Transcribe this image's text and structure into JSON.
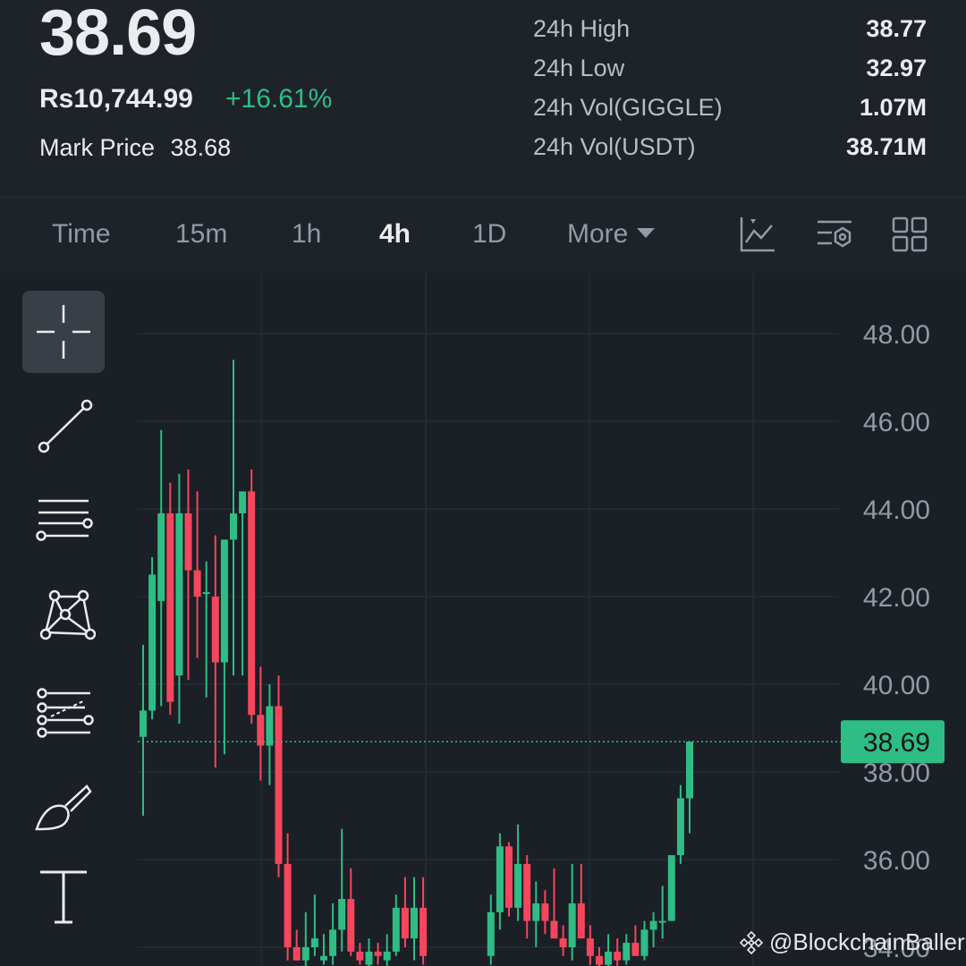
{
  "header": {
    "last_price": "38.69",
    "local_price": "Rs10,744.99",
    "change_pct": "+16.61%",
    "mark_label": "Mark Price",
    "mark_value": "38.68",
    "stats": [
      {
        "label": "24h High",
        "value": "38.77"
      },
      {
        "label": "24h Low",
        "value": "32.97"
      },
      {
        "label": "24h Vol(GIGGLE)",
        "value": "1.07M"
      },
      {
        "label": "24h Vol(USDT)",
        "value": "38.71M"
      }
    ]
  },
  "tabs": {
    "time": "Time",
    "m15": "15m",
    "h1": "1h",
    "h4": "4h",
    "d1": "1D",
    "more": "More"
  },
  "icons": {
    "indicator": "line-chart-icon",
    "settings": "chart-settings-icon",
    "layout": "grid-layout-icon",
    "crosshair": "crosshair-icon",
    "trend_line": "trend-line-icon",
    "horizontal_lines": "horizontal-lines-icon",
    "pattern": "pattern-icon",
    "fib": "fib-retracement-icon",
    "brush": "brush-icon",
    "text": "text-icon",
    "logo": "binance-logo-icon"
  },
  "colors": {
    "up": "#2ebd85",
    "down": "#f6465d",
    "background": "#1e2329"
  },
  "watermark": "@BlockchainBaller",
  "chart_data": {
    "type": "candlestick",
    "interval": "4h",
    "yticks": [
      "48.00",
      "46.00",
      "44.00",
      "42.00",
      "40.00",
      "38.00",
      "36.00",
      "34.00"
    ],
    "ylim": [
      33.6,
      48.5
    ],
    "current_price_label": "38.69",
    "current_price": 38.69,
    "candles": [
      {
        "o": 38.8,
        "h": 40.9,
        "l": 37.0,
        "c": 39.4
      },
      {
        "o": 39.4,
        "h": 42.9,
        "l": 39.2,
        "c": 42.5
      },
      {
        "o": 41.9,
        "h": 45.8,
        "l": 39.5,
        "c": 43.9
      },
      {
        "o": 43.9,
        "h": 44.6,
        "l": 39.3,
        "c": 39.6
      },
      {
        "o": 40.2,
        "h": 44.8,
        "l": 39.1,
        "c": 43.9
      },
      {
        "o": 43.9,
        "h": 44.9,
        "l": 40.1,
        "c": 42.6
      },
      {
        "o": 42.6,
        "h": 44.4,
        "l": 40.6,
        "c": 42.0
      },
      {
        "o": 42.1,
        "h": 42.8,
        "l": 39.7,
        "c": 42.1
      },
      {
        "o": 42.0,
        "h": 43.4,
        "l": 38.1,
        "c": 40.5
      },
      {
        "o": 40.5,
        "h": 42.6,
        "l": 38.4,
        "c": 43.3
      },
      {
        "o": 43.3,
        "h": 47.4,
        "l": 40.2,
        "c": 43.9
      },
      {
        "o": 43.9,
        "h": 44.4,
        "l": 40.2,
        "c": 44.4
      },
      {
        "o": 44.4,
        "h": 44.9,
        "l": 39.1,
        "c": 39.3
      },
      {
        "o": 39.3,
        "h": 40.4,
        "l": 37.8,
        "c": 38.6
      },
      {
        "o": 38.6,
        "h": 40.0,
        "l": 37.7,
        "c": 39.5
      },
      {
        "o": 39.5,
        "h": 40.2,
        "l": 35.6,
        "c": 35.9
      },
      {
        "o": 35.9,
        "h": 36.6,
        "l": 33.7,
        "c": 34.0
      },
      {
        "o": 34.0,
        "h": 34.4,
        "l": 33.7,
        "c": 33.7
      },
      {
        "o": 33.7,
        "h": 34.8,
        "l": 33.5,
        "c": 34.0
      },
      {
        "o": 34.0,
        "h": 35.2,
        "l": 33.8,
        "c": 34.2
      }
    ],
    "candles_b": [
      {
        "o": 33.7,
        "h": 34.3,
        "l": 33.6,
        "c": 33.8
      },
      {
        "o": 33.8,
        "h": 35.0,
        "l": 33.6,
        "c": 34.4
      },
      {
        "o": 34.4,
        "h": 36.7,
        "l": 33.9,
        "c": 35.1
      },
      {
        "o": 35.1,
        "h": 35.8,
        "l": 33.8,
        "c": 33.9
      },
      {
        "o": 33.9,
        "h": 34.1,
        "l": 33.6,
        "c": 33.7
      }
    ],
    "candles_c": [
      {
        "o": 33.6,
        "h": 34.2,
        "l": 33.5,
        "c": 33.9
      },
      {
        "o": 33.9,
        "h": 34.1,
        "l": 33.6,
        "c": 33.8
      }
    ],
    "candles_d": [
      {
        "o": 33.7,
        "h": 34.3,
        "l": 33.5,
        "c": 33.9
      },
      {
        "o": 33.9,
        "h": 35.2,
        "l": 33.8,
        "c": 34.9
      },
      {
        "o": 34.9,
        "h": 35.6,
        "l": 34.0,
        "c": 34.2
      },
      {
        "o": 34.2,
        "h": 35.6,
        "l": 33.7,
        "c": 34.9
      },
      {
        "o": 34.9,
        "h": 35.6,
        "l": 33.6,
        "c": 33.8
      }
    ],
    "candles_e": [
      {
        "o": 33.8,
        "h": 35.2,
        "l": 33.6,
        "c": 34.8
      },
      {
        "o": 34.8,
        "h": 36.6,
        "l": 34.4,
        "c": 36.3
      },
      {
        "o": 36.3,
        "h": 36.4,
        "l": 34.7,
        "c": 34.9
      },
      {
        "o": 34.9,
        "h": 36.8,
        "l": 34.6,
        "c": 35.9
      },
      {
        "o": 35.9,
        "h": 36.1,
        "l": 34.2,
        "c": 34.6
      },
      {
        "o": 34.6,
        "h": 35.5,
        "l": 34.0,
        "c": 35.0
      },
      {
        "o": 35.0,
        "h": 35.3,
        "l": 34.3,
        "c": 34.6
      },
      {
        "o": 34.6,
        "h": 35.8,
        "l": 34.2,
        "c": 34.2
      },
      {
        "o": 34.2,
        "h": 34.5,
        "l": 33.8,
        "c": 34.0
      },
      {
        "o": 34.0,
        "h": 35.9,
        "l": 33.7,
        "c": 35.0
      },
      {
        "o": 35.0,
        "h": 35.9,
        "l": 34.3,
        "c": 34.2
      },
      {
        "o": 34.2,
        "h": 34.5,
        "l": 33.6,
        "c": 33.8
      },
      {
        "o": 33.8,
        "h": 34.0,
        "l": 33.4,
        "c": 33.6
      },
      {
        "o": 33.6,
        "h": 34.3,
        "l": 33.4,
        "c": 33.9
      },
      {
        "o": 33.9,
        "h": 34.2,
        "l": 33.5,
        "c": 33.7
      },
      {
        "o": 33.7,
        "h": 34.3,
        "l": 33.6,
        "c": 34.1
      },
      {
        "o": 34.1,
        "h": 34.5,
        "l": 33.8,
        "c": 33.8
      },
      {
        "o": 33.8,
        "h": 34.6,
        "l": 33.7,
        "c": 34.4
      },
      {
        "o": 34.4,
        "h": 34.8,
        "l": 34.0,
        "c": 34.6
      },
      {
        "o": 34.6,
        "h": 35.4,
        "l": 34.2,
        "c": 34.6
      },
      {
        "o": 34.6,
        "h": 35.9,
        "l": 34.6,
        "c": 36.1
      },
      {
        "o": 36.1,
        "h": 37.7,
        "l": 35.9,
        "c": 37.4
      },
      {
        "o": 37.4,
        "h": 38.7,
        "l": 36.6,
        "c": 38.69
      }
    ]
  }
}
